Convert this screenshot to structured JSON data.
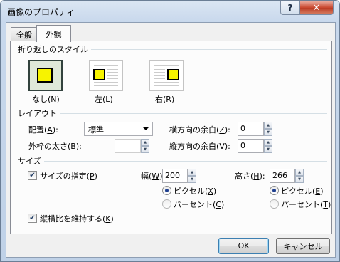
{
  "window": {
    "title": "画像のプロパティ",
    "help_glyph": "?",
    "close_glyph": "✕"
  },
  "tabs": [
    {
      "label": "全般",
      "active": false
    },
    {
      "label": "外観",
      "active": true
    }
  ],
  "wrap_style": {
    "section_label": "折り返しのスタイル",
    "options": [
      {
        "label": "なし(N)",
        "selected": true
      },
      {
        "label": "左(L)",
        "selected": false
      },
      {
        "label": "右(R)",
        "selected": false
      }
    ]
  },
  "layout": {
    "section_label": "レイアウト",
    "placement_label": "配置(A):",
    "placement_value": "標準",
    "border_label": "外枠の太さ(B):",
    "border_value": "",
    "hspace_label": "横方向の余白(Z):",
    "hspace_value": "0",
    "vspace_label": "縦方向の余白(V):",
    "vspace_value": "0"
  },
  "size": {
    "section_label": "サイズ",
    "specify_label": "サイズの指定(P)",
    "specify_checked": true,
    "width_label": "幅(W):",
    "width_value": "200",
    "height_label": "高さ(H):",
    "height_value": "266",
    "width_unit_pixel": "ピクセル(X)",
    "width_unit_percent": "パーセント(C)",
    "height_unit_pixel": "ピクセル(E)",
    "height_unit_percent": "パーセント(T)",
    "keep_ratio_label": "縦横比を維持する(K)",
    "keep_ratio_checked": true
  },
  "footer": {
    "ok_label": "OK",
    "cancel_label": "キャンセル"
  },
  "colors": {
    "icon_yellow": "#f7f300",
    "title_gradient_top": "#dbe6f3"
  }
}
